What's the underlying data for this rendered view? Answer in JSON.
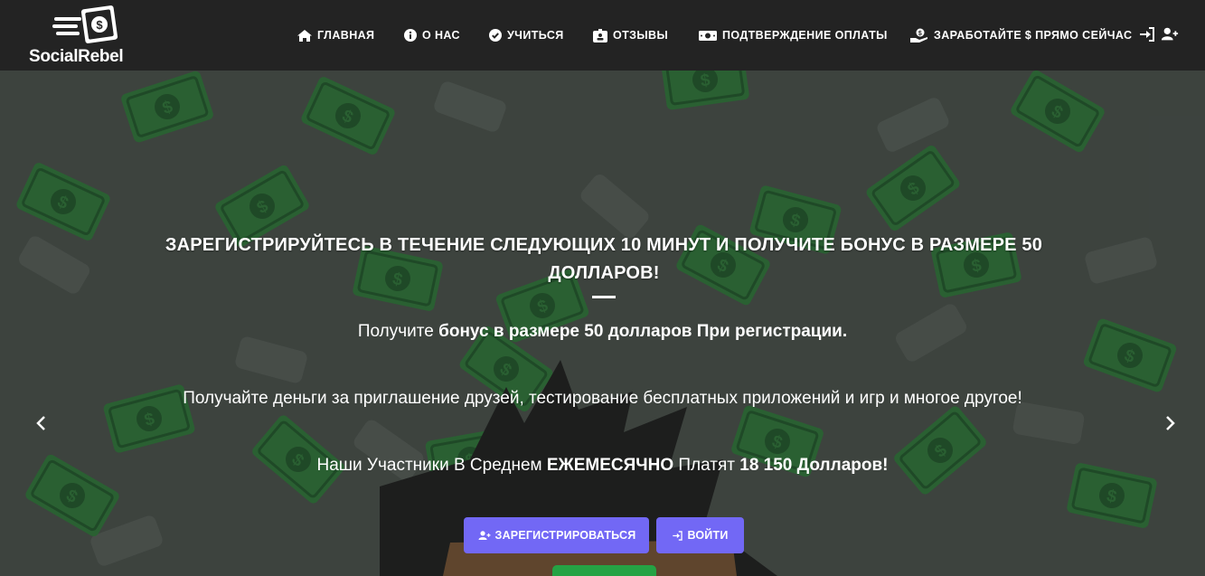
{
  "brand": {
    "name": "SocialRebel"
  },
  "nav": {
    "items": [
      {
        "label": "ГЛАВНАЯ",
        "icon": "home-icon"
      },
      {
        "label": "О НАС",
        "icon": "info-circle-icon"
      },
      {
        "label": "УЧИТЬСЯ",
        "icon": "check-circle-icon"
      },
      {
        "label": "ОТЗЫВЫ",
        "icon": "id-badge-icon"
      },
      {
        "label": "ПОДТВЕРЖДЕНИЕ ОПЛАТЫ",
        "icon": "money-bill-icon"
      },
      {
        "label": "ЗАРАБОТАЙТЕ $ ПРЯМО СЕЙЧАС",
        "icon": "hand-holding-usd-icon"
      }
    ],
    "login_icon": "sign-in-icon",
    "register_icon": "user-plus-icon"
  },
  "hero": {
    "title": "ЗАРЕГИСТРИРУЙТЕСЬ В ТЕЧЕНИЕ СЛЕДУЮЩИХ 10 МИНУТ И ПОЛУЧИТЕ БОНУС В РАЗМЕРЕ 50 ДОЛЛАРОВ!",
    "line1_a": "Получите ",
    "line1_b": "бонус в размере 50 долларов При регистрации.",
    "line2": "Получайте деньги за приглашение друзей, тестирование бесплатных приложений и игр и многое другое!",
    "line3_a": "Наши Участники В Среднем ",
    "line3_b": "ЕЖЕМЕСЯЧНО",
    "line3_c": " Платят ",
    "line3_d": "18 150 Долларов!",
    "register_button": "ЗАРЕГИСТРИРОВАТЬСЯ",
    "login_button": "ВОЙТИ"
  },
  "colors": {
    "navbar_bg": "#232323",
    "hero_bg": "#414743",
    "accent": "#7268f5",
    "green": "#25a244",
    "bill_green": "#2a6b34"
  }
}
